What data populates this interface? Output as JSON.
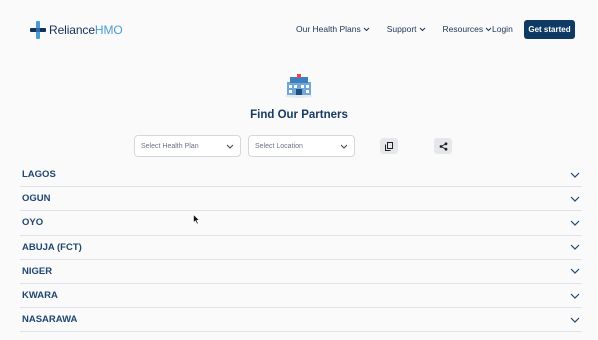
{
  "brand": {
    "name_main": "Reliance",
    "name_accent": "HMO",
    "logo_icon": "cross-plus-icon",
    "colors": {
      "navy": "#12325a",
      "accent_blue": "#4a9cd6",
      "cta_bg": "#0f3a63"
    }
  },
  "nav": {
    "items": [
      {
        "label": "Our Health Plans",
        "icon": "chevron-down-icon"
      },
      {
        "label": "Support",
        "icon": "chevron-down-icon"
      },
      {
        "label": "Resources",
        "icon": "chevron-down-icon"
      }
    ],
    "login_label": "Login",
    "cta_label": "Get started"
  },
  "page": {
    "hero_icon": "hospital-building-icon",
    "title": "Find Our Partners"
  },
  "filters": {
    "health_plan_placeholder": "Select Health Plan",
    "location_placeholder": "Select Location",
    "copy_icon": "copy-icon",
    "share_icon": "share-icon"
  },
  "regions": [
    {
      "label": "LAGOS"
    },
    {
      "label": "OGUN"
    },
    {
      "label": "OYO"
    },
    {
      "label": "ABUJA (FCT)"
    },
    {
      "label": "NIGER"
    },
    {
      "label": "KWARA"
    },
    {
      "label": "NASARAWA"
    }
  ]
}
